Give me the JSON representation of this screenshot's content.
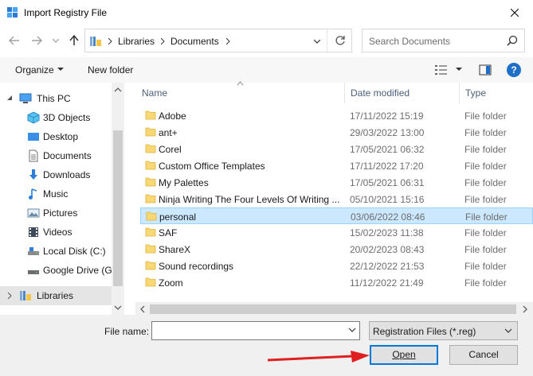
{
  "window": {
    "title": "Import Registry File"
  },
  "nav": {
    "path": [
      "Libraries",
      "Documents"
    ],
    "search_placeholder": "Search Documents"
  },
  "toolbar": {
    "organize_label": "Organize",
    "new_folder_label": "New folder",
    "help_label": "?"
  },
  "sidebar": {
    "items": [
      {
        "label": "This PC",
        "icon": "this-pc-icon"
      },
      {
        "label": "3D Objects",
        "icon": "3d-objects-icon"
      },
      {
        "label": "Desktop",
        "icon": "desktop-icon"
      },
      {
        "label": "Documents",
        "icon": "documents-icon"
      },
      {
        "label": "Downloads",
        "icon": "downloads-icon"
      },
      {
        "label": "Music",
        "icon": "music-icon"
      },
      {
        "label": "Pictures",
        "icon": "pictures-icon"
      },
      {
        "label": "Videos",
        "icon": "videos-icon"
      },
      {
        "label": "Local Disk (C:)",
        "icon": "local-disk-icon"
      },
      {
        "label": "Google Drive (G:",
        "icon": "google-drive-icon"
      },
      {
        "label": "Libraries",
        "icon": "libraries-icon"
      }
    ]
  },
  "columns": {
    "name": "Name",
    "date": "Date modified",
    "type": "Type"
  },
  "files": [
    {
      "name": "Adobe",
      "date": "17/11/2022 15:19",
      "type": "File folder"
    },
    {
      "name": "ant+",
      "date": "29/03/2022 13:00",
      "type": "File folder"
    },
    {
      "name": "Corel",
      "date": "17/05/2021 06:32",
      "type": "File folder"
    },
    {
      "name": "Custom Office Templates",
      "date": "17/11/2022 17:20",
      "type": "File folder"
    },
    {
      "name": "My Palettes",
      "date": "17/05/2021 06:31",
      "type": "File folder"
    },
    {
      "name": "Ninja Writing The Four Levels Of Writing ...",
      "date": "05/10/2021 15:16",
      "type": "File folder"
    },
    {
      "name": "personal",
      "date": "03/06/2022 08:46",
      "type": "File folder"
    },
    {
      "name": "SAF",
      "date": "15/02/2023 11:38",
      "type": "File folder"
    },
    {
      "name": "ShareX",
      "date": "20/02/2023 08:43",
      "type": "File folder"
    },
    {
      "name": "Sound recordings",
      "date": "22/12/2022 21:53",
      "type": "File folder"
    },
    {
      "name": "Zoom",
      "date": "11/12/2022 21:49",
      "type": "File folder"
    }
  ],
  "footer": {
    "file_name_label": "File name:",
    "file_name_value": "",
    "filter_value": "Registration Files (*.reg)",
    "open_label": "Open",
    "cancel_label": "Cancel"
  },
  "colors": {
    "accent": "#0078d7",
    "selection": "#cce8ff",
    "folder": "#f8d775",
    "annotation_arrow": "#e02020"
  }
}
